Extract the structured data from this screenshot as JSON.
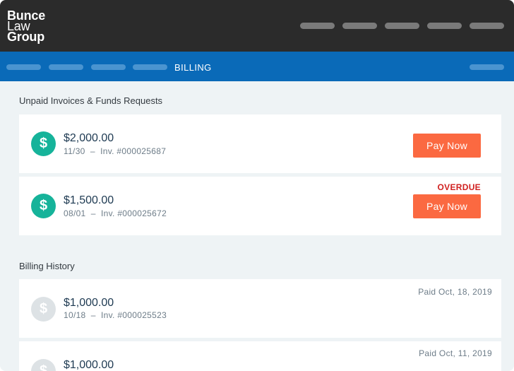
{
  "app": {
    "logo_lines": [
      "Bunce",
      "Law",
      "Group"
    ]
  },
  "subnav": {
    "title": "BILLING"
  },
  "unpaid": {
    "heading": "Unpaid Invoices & Funds Requests",
    "items": [
      {
        "icon": "$",
        "amount": "$2,000.00",
        "meta": "11/30  –  Inv. #000025687",
        "button": "Pay Now",
        "status": ""
      },
      {
        "icon": "$",
        "amount": "$1,500.00",
        "meta": "08/01  –  Inv. #000025672",
        "button": "Pay Now",
        "status": "OVERDUE"
      }
    ]
  },
  "history": {
    "heading": "Billing History",
    "items": [
      {
        "icon": "$",
        "amount": "$1,000.00",
        "meta": "10/18  –  Inv. #000025523",
        "paid": "Paid Oct, 18, 2019"
      },
      {
        "icon": "$",
        "amount": "$1,000.00",
        "paid": "Paid Oct, 11, 2019"
      }
    ]
  },
  "colors": {
    "topbar": "#2b2b2b",
    "subnav": "#0a6ab8",
    "coin_unpaid": "#16b39a",
    "coin_paid": "#dde2e5",
    "pay_button": "#fb6941",
    "overdue": "#d0201f"
  }
}
